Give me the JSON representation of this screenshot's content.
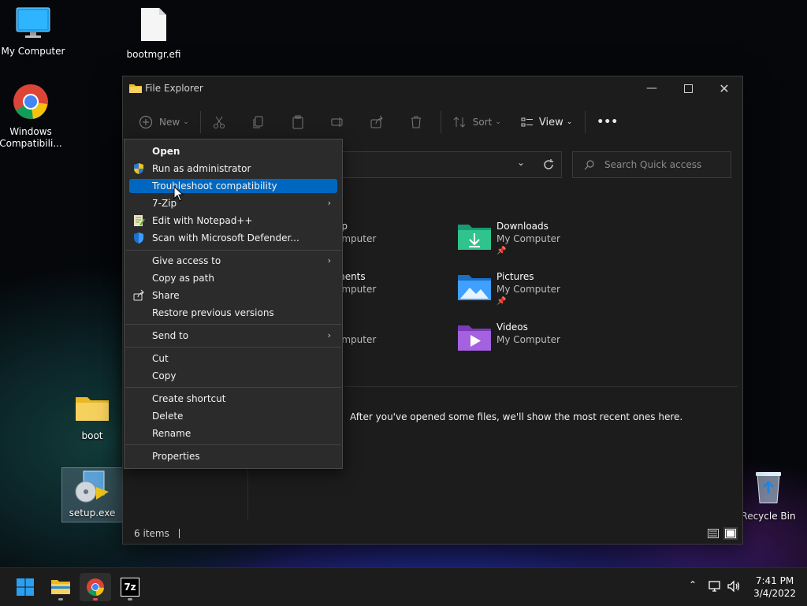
{
  "desktop": {
    "icons": [
      {
        "label": "My Computer"
      },
      {
        "label": "bootmgr.efi"
      },
      {
        "label": "Windows Compatibili..."
      },
      {
        "label": "boot"
      },
      {
        "label": "setup.exe"
      },
      {
        "label": "Recycle Bin"
      }
    ]
  },
  "explorer": {
    "title": "File Explorer",
    "toolbar": {
      "new_label": "New",
      "sort_label": "Sort",
      "view_label": "View",
      "more_label": "•••"
    },
    "search_placeholder": "Search Quick access",
    "quick_access": [
      {
        "name": "op",
        "location": "omputer"
      },
      {
        "name": "ments",
        "location": "omputer"
      },
      {
        "name": "",
        "location": "omputer"
      },
      {
        "name": "Downloads",
        "location": "My Computer"
      },
      {
        "name": "Pictures",
        "location": "My Computer"
      },
      {
        "name": "Videos",
        "location": "My Computer"
      }
    ],
    "recent_message": "After you've opened some files, we'll show the most recent ones here.",
    "status": {
      "items": "6 items"
    }
  },
  "context_menu": {
    "items": [
      {
        "label": "Open"
      },
      {
        "label": "Run as administrator"
      },
      {
        "label": "Troubleshoot compatibility"
      },
      {
        "label": "7-Zip"
      },
      {
        "label": "Edit with Notepad++"
      },
      {
        "label": "Scan with Microsoft Defender..."
      },
      {
        "label": "Give access to"
      },
      {
        "label": "Copy as path"
      },
      {
        "label": "Share"
      },
      {
        "label": "Restore previous versions"
      },
      {
        "label": "Send to"
      },
      {
        "label": "Cut"
      },
      {
        "label": "Copy"
      },
      {
        "label": "Create shortcut"
      },
      {
        "label": "Delete"
      },
      {
        "label": "Rename"
      },
      {
        "label": "Properties"
      }
    ]
  },
  "taskbar": {
    "time": "7:41 PM",
    "date": "3/4/2022",
    "sevenzip_label": "7z"
  },
  "colors": {
    "accent": "#0067c0",
    "window_bg": "#1c1c1c",
    "menu_bg": "#2b2b2b"
  }
}
